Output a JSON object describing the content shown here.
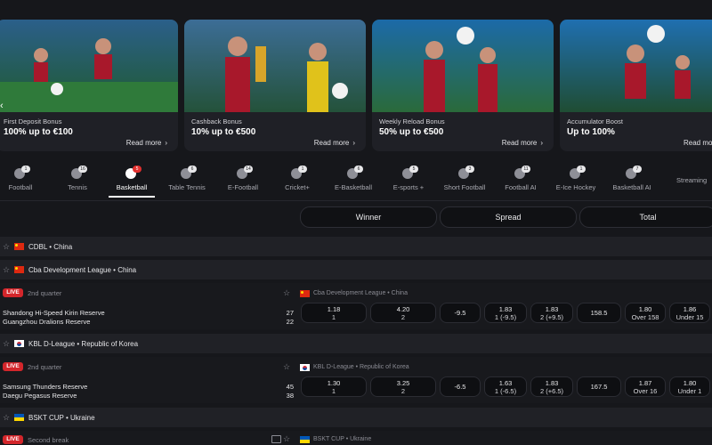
{
  "promos": [
    {
      "title": "First Deposit Bonus",
      "value": "100% up to €100",
      "link": "Read more"
    },
    {
      "title": "Cashback Bonus",
      "value": "10% up to €500",
      "link": "Read more"
    },
    {
      "title": "Weekly Reload Bonus",
      "value": "50% up to €500",
      "link": "Read more"
    },
    {
      "title": "Accumulator Boost",
      "value": "Up to 100%",
      "link": "Read more"
    }
  ],
  "sports_tabs": [
    {
      "label": "Football",
      "count": "1"
    },
    {
      "label": "Tennis",
      "count": "16"
    },
    {
      "label": "Basketball",
      "count": "5",
      "active": true
    },
    {
      "label": "Table Tennis",
      "count": "6"
    },
    {
      "label": "E-Football",
      "count": "14"
    },
    {
      "label": "Cricket+",
      "count": "1"
    },
    {
      "label": "E-Basketball",
      "count": "6"
    },
    {
      "label": "E-sports +",
      "count": "5"
    },
    {
      "label": "Short Football",
      "count": "3"
    },
    {
      "label": "Football AI",
      "count": "11"
    },
    {
      "label": "E-Ice Hockey",
      "count": "1"
    },
    {
      "label": "Basketball AI",
      "count": "7"
    },
    {
      "label": "Streaming",
      "count": ""
    }
  ],
  "markets": {
    "winner": "Winner",
    "spread": "Spread",
    "total": "Total"
  },
  "leagues": [
    {
      "name": "CDBL • China",
      "flag": "cn"
    },
    {
      "name": "Cba Development League • China",
      "flag": "cn"
    },
    {
      "name": "KBL D-League • Republic of Korea",
      "flag": "kr"
    },
    {
      "name": "BSKT CUP • Ukraine",
      "flag": "ua"
    }
  ],
  "matches": [
    {
      "live": "LIVE",
      "period": "2nd quarter",
      "home": "Shandong Hi-Speed Kirin Reserve",
      "away": "Guangzhou Dralions Reserve",
      "home_score": "27",
      "away_score": "22",
      "league": "Cba Development League • China",
      "odds": [
        {
          "v": "1.18",
          "s": "1"
        },
        {
          "v": "4.20",
          "s": "2"
        },
        {
          "v": "-9.5",
          "s": ""
        },
        {
          "v": "1.83",
          "s": "1 (-9.5)"
        },
        {
          "v": "1.83",
          "s": "2 (+9.5)"
        },
        {
          "v": "158.5",
          "s": ""
        },
        {
          "v": "1.80",
          "s": "Over 158"
        },
        {
          "v": "1.86",
          "s": "Under 15"
        }
      ]
    },
    {
      "live": "LIVE",
      "period": "2nd quarter",
      "home": "Samsung Thunders Reserve",
      "away": "Daegu Pegasus Reserve",
      "home_score": "45",
      "away_score": "38",
      "league": "KBL D-League • Republic of Korea",
      "odds": [
        {
          "v": "1.30",
          "s": "1"
        },
        {
          "v": "3.25",
          "s": "2"
        },
        {
          "v": "-6.5",
          "s": ""
        },
        {
          "v": "1.63",
          "s": "1 (-6.5)"
        },
        {
          "v": "1.83",
          "s": "2 (+6.5)"
        },
        {
          "v": "167.5",
          "s": ""
        },
        {
          "v": "1.87",
          "s": "Over 16"
        },
        {
          "v": "1.80",
          "s": "Under 1"
        }
      ]
    },
    {
      "live": "LIVE",
      "period": "Second break",
      "league": "BSKT CUP • Ukraine"
    }
  ],
  "colors": {
    "live": "#d3262b",
    "background": "#16171b",
    "row": "#202126"
  }
}
